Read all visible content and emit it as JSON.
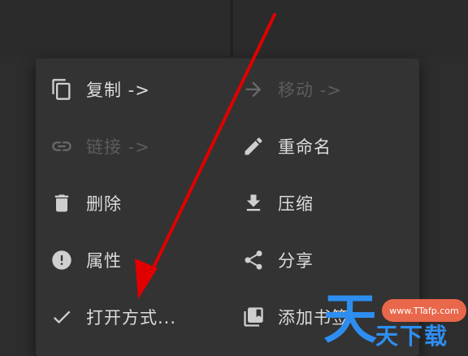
{
  "menu": {
    "left": [
      {
        "label": "复制 ->",
        "icon": "copy-icon",
        "enabled": true
      },
      {
        "label": "链接 ->",
        "icon": "link-icon",
        "enabled": false
      },
      {
        "label": "删除",
        "icon": "trash-icon",
        "enabled": true
      },
      {
        "label": "属性",
        "icon": "info-icon",
        "enabled": true
      },
      {
        "label": "打开方式...",
        "icon": "check-icon",
        "enabled": true
      }
    ],
    "right": [
      {
        "label": "移动 ->",
        "icon": "move-icon",
        "enabled": false
      },
      {
        "label": "重命名",
        "icon": "pencil-icon",
        "enabled": true
      },
      {
        "label": "压缩",
        "icon": "download-icon",
        "enabled": true
      },
      {
        "label": "分享",
        "icon": "share-icon",
        "enabled": true
      },
      {
        "label": "添加书签",
        "icon": "bookmark-icon",
        "enabled": true
      }
    ]
  },
  "colors": {
    "menu_bg": "#333333",
    "text": "#dcdcdc",
    "disabled_text": "#5c5c5c",
    "annotation_arrow": "#e00000",
    "watermark_blue": "#2e8ef0",
    "watermark_orange": "#e9674a"
  },
  "watermark": {
    "url": "www.TTafp.com",
    "big_char": "天",
    "text": "天下载"
  }
}
